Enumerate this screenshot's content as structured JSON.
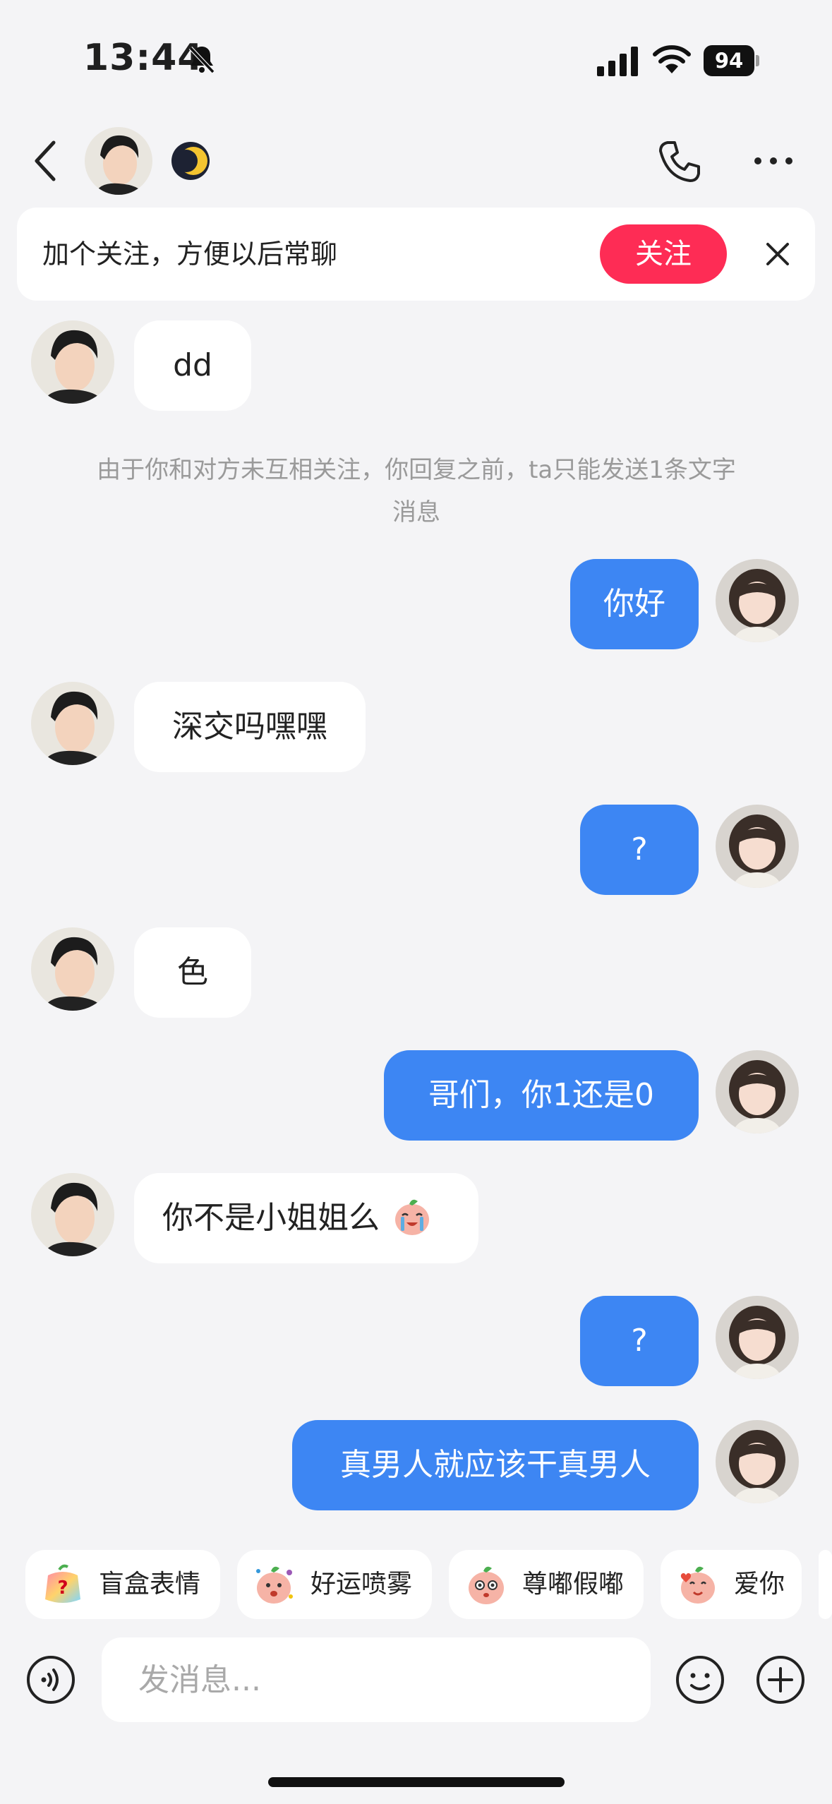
{
  "status_bar": {
    "time": "13:44",
    "battery": "94"
  },
  "header": {
    "back_icon": "chevron-left-icon",
    "moon_icon": "crescent-moon-icon",
    "call_icon": "phone-icon",
    "more_icon": "ellipsis-icon"
  },
  "follow_banner": {
    "text": "加个关注，方便以后常聊",
    "button_label": "关注",
    "accent_color": "#fe2c55"
  },
  "system_notice": {
    "line1": "由于你和对方未互相关注，你回复之前，ta只能发送1条文字",
    "line2": "消息"
  },
  "messages": [
    {
      "from": "contact",
      "text": "dd"
    },
    {
      "from": "me",
      "text": "你好"
    },
    {
      "from": "contact",
      "text": "深交吗嘿嘿"
    },
    {
      "from": "me",
      "text": "?"
    },
    {
      "from": "contact",
      "text": "色"
    },
    {
      "from": "me",
      "text": "哥们，你1还是0"
    },
    {
      "from": "contact",
      "text": "你不是小姐姐么",
      "emoji": "sticker-crying-icon"
    },
    {
      "from": "me",
      "text": "?"
    },
    {
      "from": "me",
      "text": "真男人就应该干真男人"
    }
  ],
  "sticker_chips": [
    {
      "label": "盲盒表情",
      "icon": "blind-box-sticker-icon"
    },
    {
      "label": "好运喷雾",
      "icon": "luck-spray-sticker-icon"
    },
    {
      "label": "尊嘟假嘟",
      "icon": "really-sticker-icon"
    },
    {
      "label": "爱你",
      "icon": "love-you-sticker-icon"
    }
  ],
  "composer": {
    "placeholder": "发消息...",
    "value": ""
  },
  "colors": {
    "outgoing_bubble": "#3d86f3",
    "incoming_bubble": "#ffffff",
    "background": "#f4f4f6"
  }
}
